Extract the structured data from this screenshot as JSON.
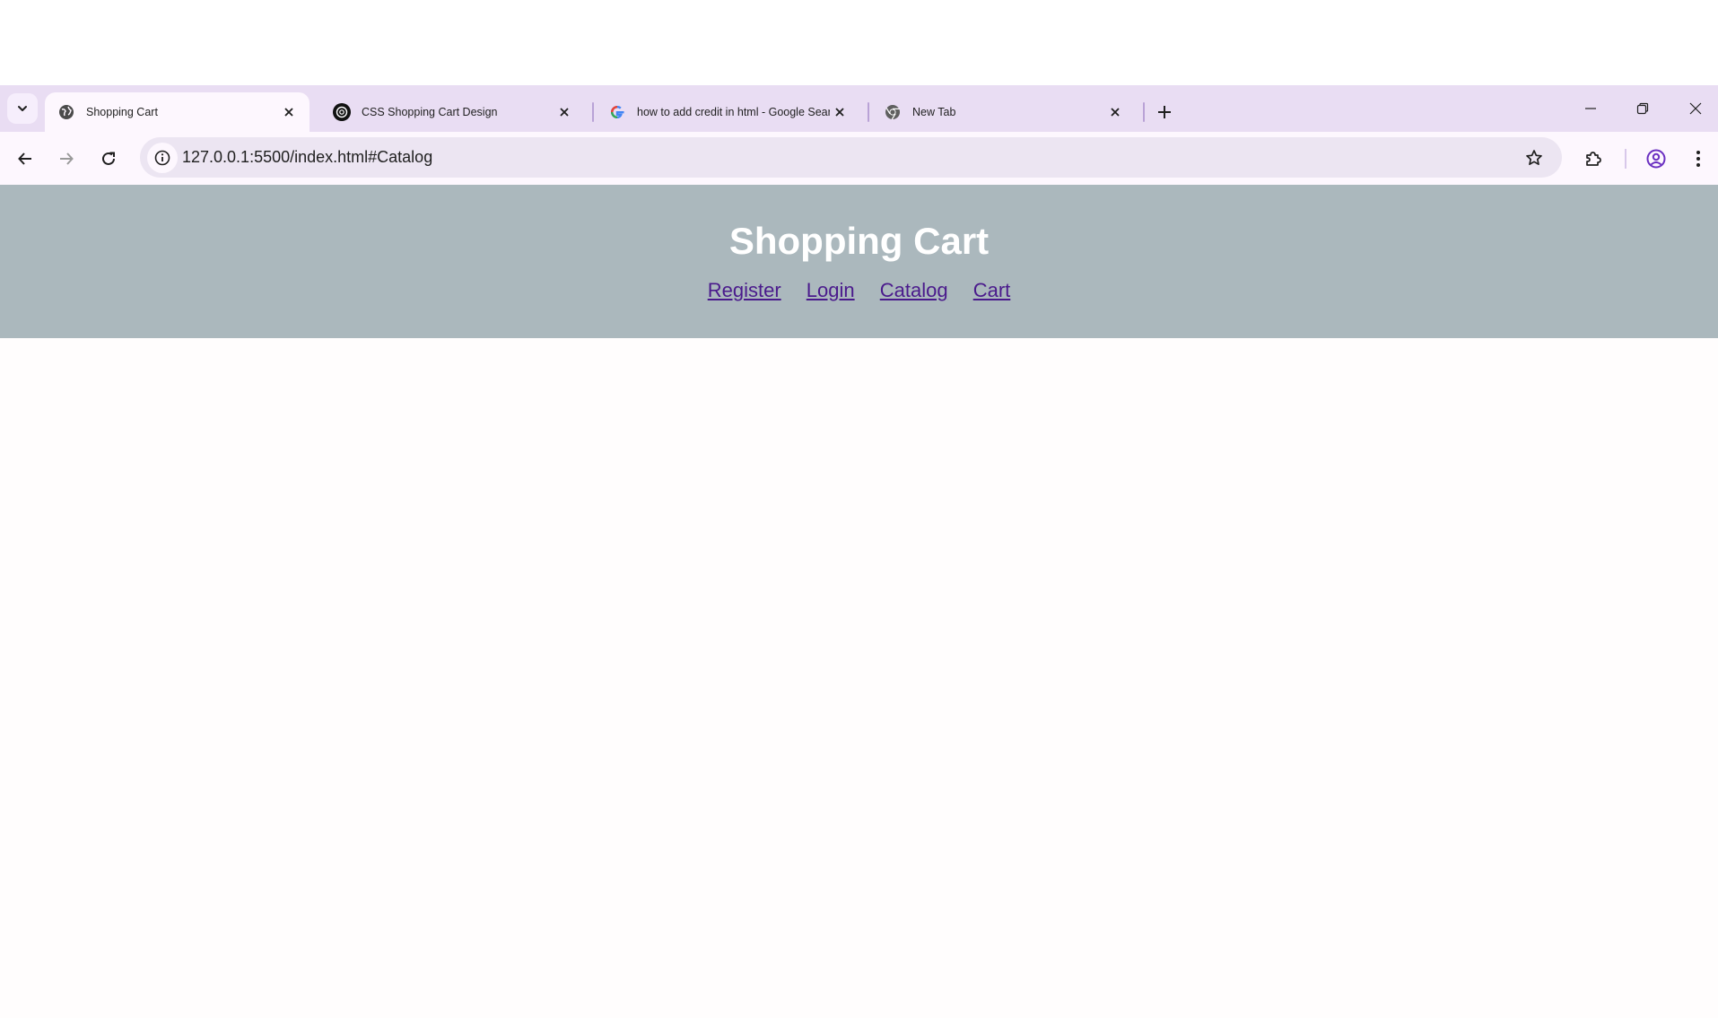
{
  "browser": {
    "tabs": [
      {
        "title": "Shopping Cart",
        "icon": "globe-icon",
        "active": true
      },
      {
        "title": "CSS Shopping Cart Design",
        "icon": "openai-icon",
        "active": false
      },
      {
        "title": "how to add credit in html - Google Search",
        "icon": "google-icon",
        "active": false
      },
      {
        "title": "New Tab",
        "icon": "chrome-icon",
        "active": false
      }
    ],
    "url": "127.0.0.1:5500/index.html#Catalog",
    "colors": {
      "tab_strip": "#e9ddf3",
      "toolbar": "#fdf7fe",
      "omnibox": "#ece5f2",
      "profile_accent": "#6a2fc1"
    }
  },
  "page": {
    "title": "Shopping Cart",
    "nav": [
      "Register",
      "Login",
      "Catalog",
      "Cart"
    ],
    "colors": {
      "header_bg": "#abb8bd",
      "title": "#ffffff",
      "link": "#4a1a8c"
    }
  }
}
